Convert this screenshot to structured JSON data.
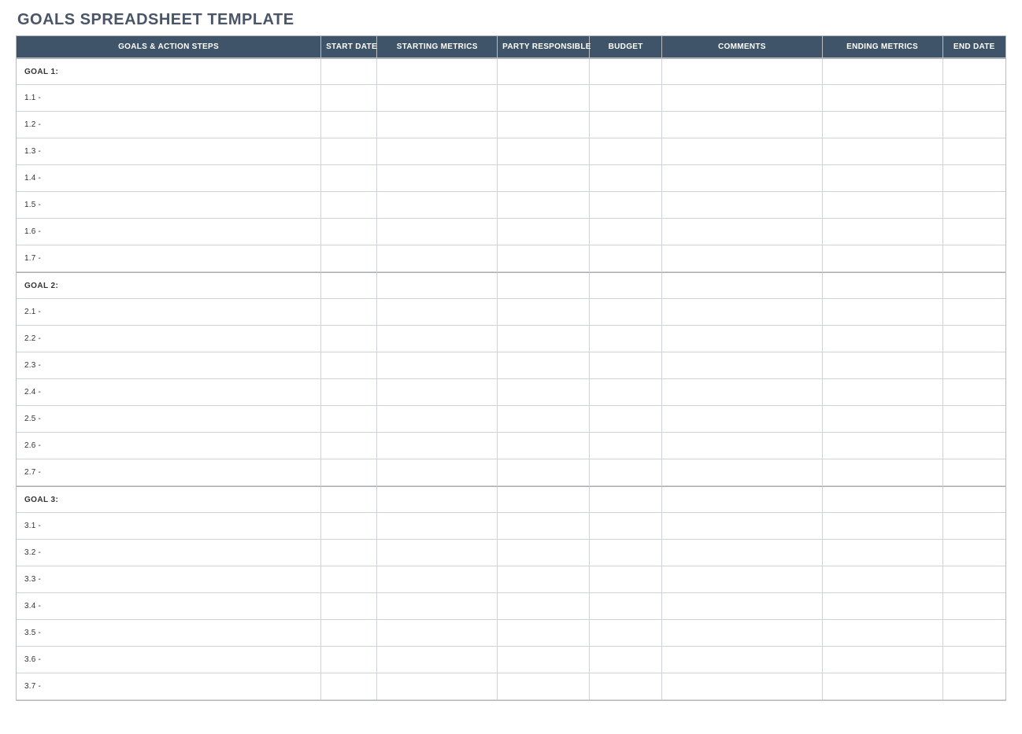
{
  "title": "GOALS SPREADSHEET TEMPLATE",
  "columns": {
    "goals": "GOALS & ACTION STEPS",
    "start_date": "START DATE",
    "starting_metrics": "STARTING METRICS",
    "party": "PARTY RESPONSIBLE",
    "budget": "BUDGET",
    "comments": "COMMENTS",
    "ending_metrics": "ENDING METRICS",
    "end_date": "END DATE"
  },
  "goals": [
    {
      "header": "GOAL 1:",
      "steps": [
        "1.1 -",
        "1.2 -",
        "1.3 -",
        "1.4 -",
        "1.5 -",
        "1.6 -",
        "1.7 -"
      ]
    },
    {
      "header": "GOAL 2:",
      "steps": [
        "2.1 -",
        "2.2 -",
        "2.3 -",
        "2.4 -",
        "2.5 -",
        "2.6 -",
        "2.7 -"
      ]
    },
    {
      "header": "GOAL 3:",
      "steps": [
        "3.1 -",
        "3.2 -",
        "3.3 -",
        "3.4 -",
        "3.5 -",
        "3.6 -",
        "3.7 -"
      ]
    }
  ]
}
